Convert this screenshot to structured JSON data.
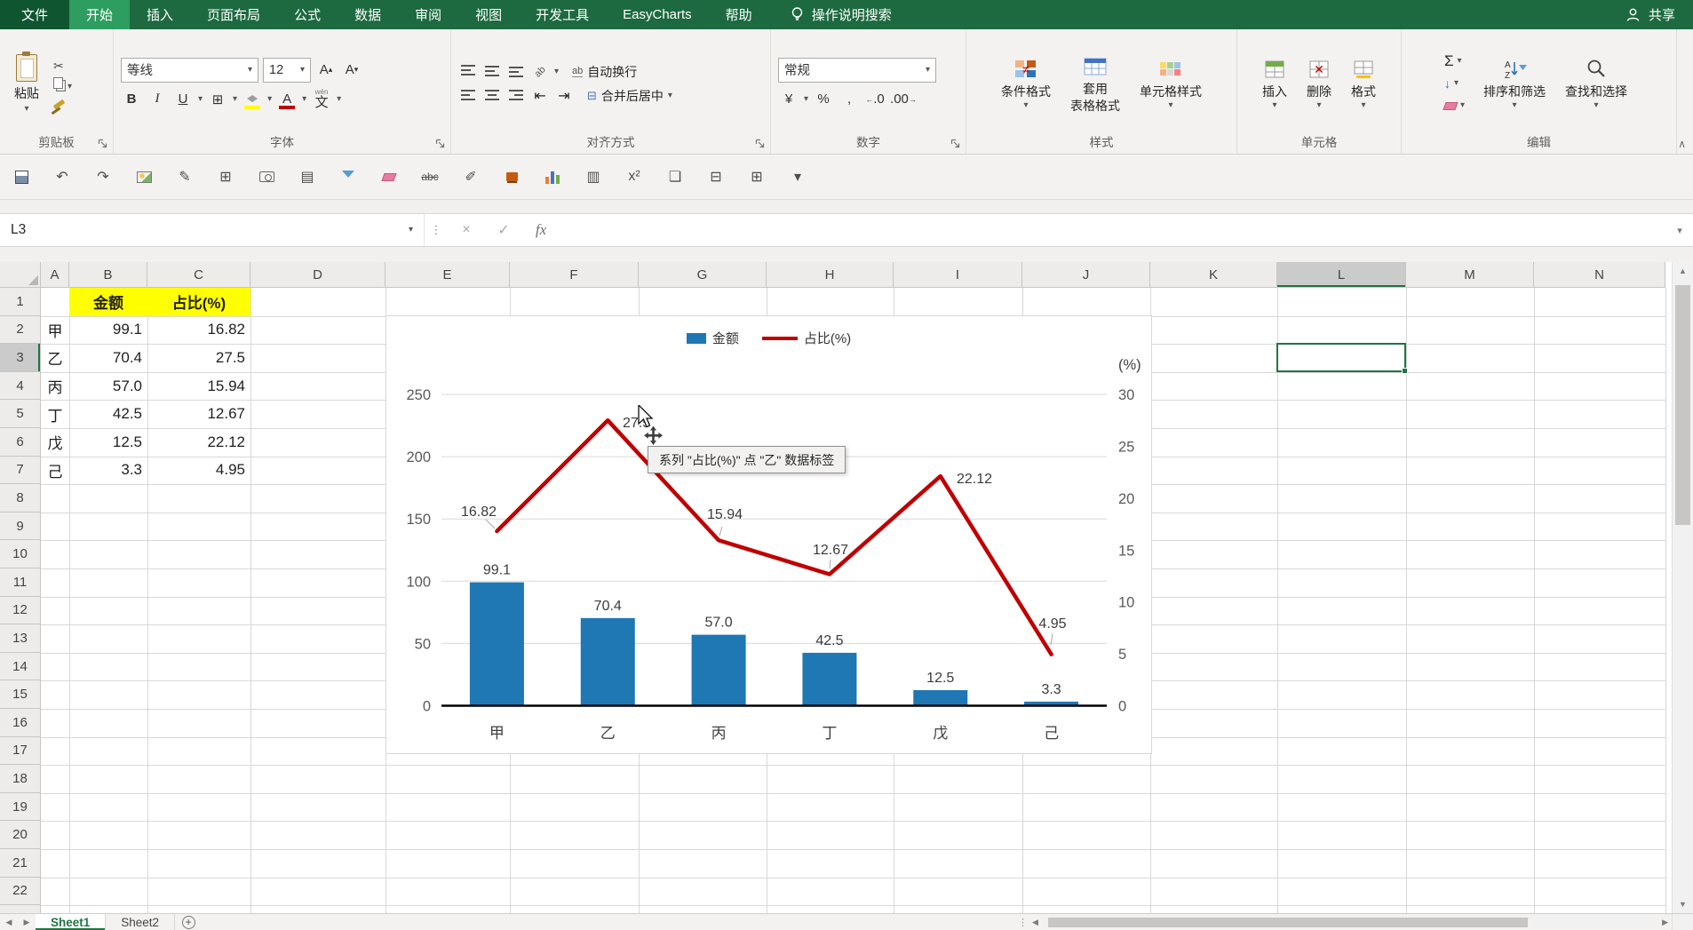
{
  "colors": {
    "accent_green": "#217346",
    "bar_blue": "#1F77B4",
    "line_red": "#C00000",
    "highlight_yellow": "#FFFF00"
  },
  "tabbar": {
    "tabs": [
      {
        "label": "文件",
        "style": "file"
      },
      {
        "label": "开始",
        "active": true
      },
      {
        "label": "插入"
      },
      {
        "label": "页面布局"
      },
      {
        "label": "公式"
      },
      {
        "label": "数据"
      },
      {
        "label": "审阅"
      },
      {
        "label": "视图"
      },
      {
        "label": "开发工具"
      },
      {
        "label": "EasyCharts"
      },
      {
        "label": "帮助"
      }
    ],
    "tellme": "操作说明搜索",
    "share": "共享"
  },
  "ribbon": {
    "clipboard": {
      "label": "剪贴板",
      "paste": "粘贴"
    },
    "font": {
      "label": "字体",
      "font_name": "等线",
      "font_size": "12",
      "phonetic": "文",
      "phonetic_hint": "wén"
    },
    "alignment": {
      "label": "对齐方式",
      "wrap": "自动换行",
      "merge": "合并后居中"
    },
    "number": {
      "label": "数字",
      "format": "常规"
    },
    "styles": {
      "label": "样式",
      "conditional": "条件格式",
      "table_line1": "套用",
      "table_line2": "表格格式",
      "cell_styles": "单元格样式"
    },
    "cells": {
      "label": "单元格",
      "insert": "插入",
      "delete": "删除",
      "format": "格式"
    },
    "editing": {
      "label": "编辑",
      "sum": "Σ",
      "sort_filter": "排序和筛选",
      "find_select": "查找和选择"
    }
  },
  "qat_icons": [
    "save-icon",
    "undo-icon",
    "redo-icon",
    "picture-icon",
    "pencil-edit-icon",
    "add-table-icon",
    "camera-icon",
    "chart-page-icon",
    "filter-icon",
    "eraser-icon",
    "strikethrough-icon",
    "shape-pen-icon",
    "paint-bucket-icon",
    "bar-chart-icon",
    "chart-frame-icon",
    "superscript-icon",
    "comment-icon",
    "merge-cells-icon",
    "borders-icon",
    "qat-more-icon"
  ],
  "formula_bar": {
    "name_box": "L3",
    "fx_label": "fx"
  },
  "grid": {
    "columns": [
      "A",
      "B",
      "C",
      "D",
      "E",
      "F",
      "G",
      "H",
      "I",
      "J",
      "K",
      "L",
      "M",
      "N"
    ],
    "row_count": 23,
    "selected_cell": "L3",
    "selected_column": "L",
    "selected_row": 3,
    "cells": {
      "B1": "金额",
      "C1": "占比(%)",
      "data": [
        {
          "row": 2,
          "cat": "甲",
          "amount": "99.1",
          "pct": "16.82"
        },
        {
          "row": 3,
          "cat": "乙",
          "amount": "70.4",
          "pct": "27.5"
        },
        {
          "row": 4,
          "cat": "丙",
          "amount": "57.0",
          "pct": "15.94"
        },
        {
          "row": 5,
          "cat": "丁",
          "amount": "42.5",
          "pct": "12.67"
        },
        {
          "row": 6,
          "cat": "戊",
          "amount": "12.5",
          "pct": "22.12"
        },
        {
          "row": 7,
          "cat": "己",
          "amount": "3.3",
          "pct": "4.95"
        }
      ]
    }
  },
  "chart_data": {
    "type": "combo",
    "categories": [
      "甲",
      "乙",
      "丙",
      "丁",
      "戊",
      "己"
    ],
    "series": [
      {
        "name": "金额",
        "type": "bar",
        "axis": "left",
        "color": "#1F77B4",
        "values": [
          99.1,
          70.4,
          57.0,
          42.5,
          12.5,
          3.3
        ],
        "labels": [
          "99.1",
          "70.4",
          "57.0",
          "42.5",
          "12.5",
          "3.3"
        ]
      },
      {
        "name": "占比(%)",
        "type": "line",
        "axis": "right",
        "color": "#C00000",
        "values": [
          16.82,
          27.5,
          15.94,
          12.67,
          22.12,
          4.95
        ],
        "labels": [
          "16.82",
          "27.5",
          "15.94",
          "12.67",
          "22.12",
          "4.95"
        ]
      }
    ],
    "left_axis": {
      "min": 0,
      "max": 250,
      "step": 50,
      "ticks": [
        "0",
        "50",
        "100",
        "150",
        "200",
        "250"
      ]
    },
    "right_axis": {
      "min": 0,
      "max": 30,
      "step": 5,
      "ticks": [
        "0",
        "5",
        "10",
        "15",
        "20",
        "25",
        "30"
      ],
      "title": "(%)"
    },
    "legend_position": "top",
    "gridlines": true
  },
  "chart_tooltip": "系列 \"占比(%)\" 点 \"乙\" 数据标签",
  "sheetbar": {
    "tabs": [
      {
        "label": "Sheet1",
        "active": true
      },
      {
        "label": "Sheet2"
      }
    ],
    "add_label": "+"
  }
}
